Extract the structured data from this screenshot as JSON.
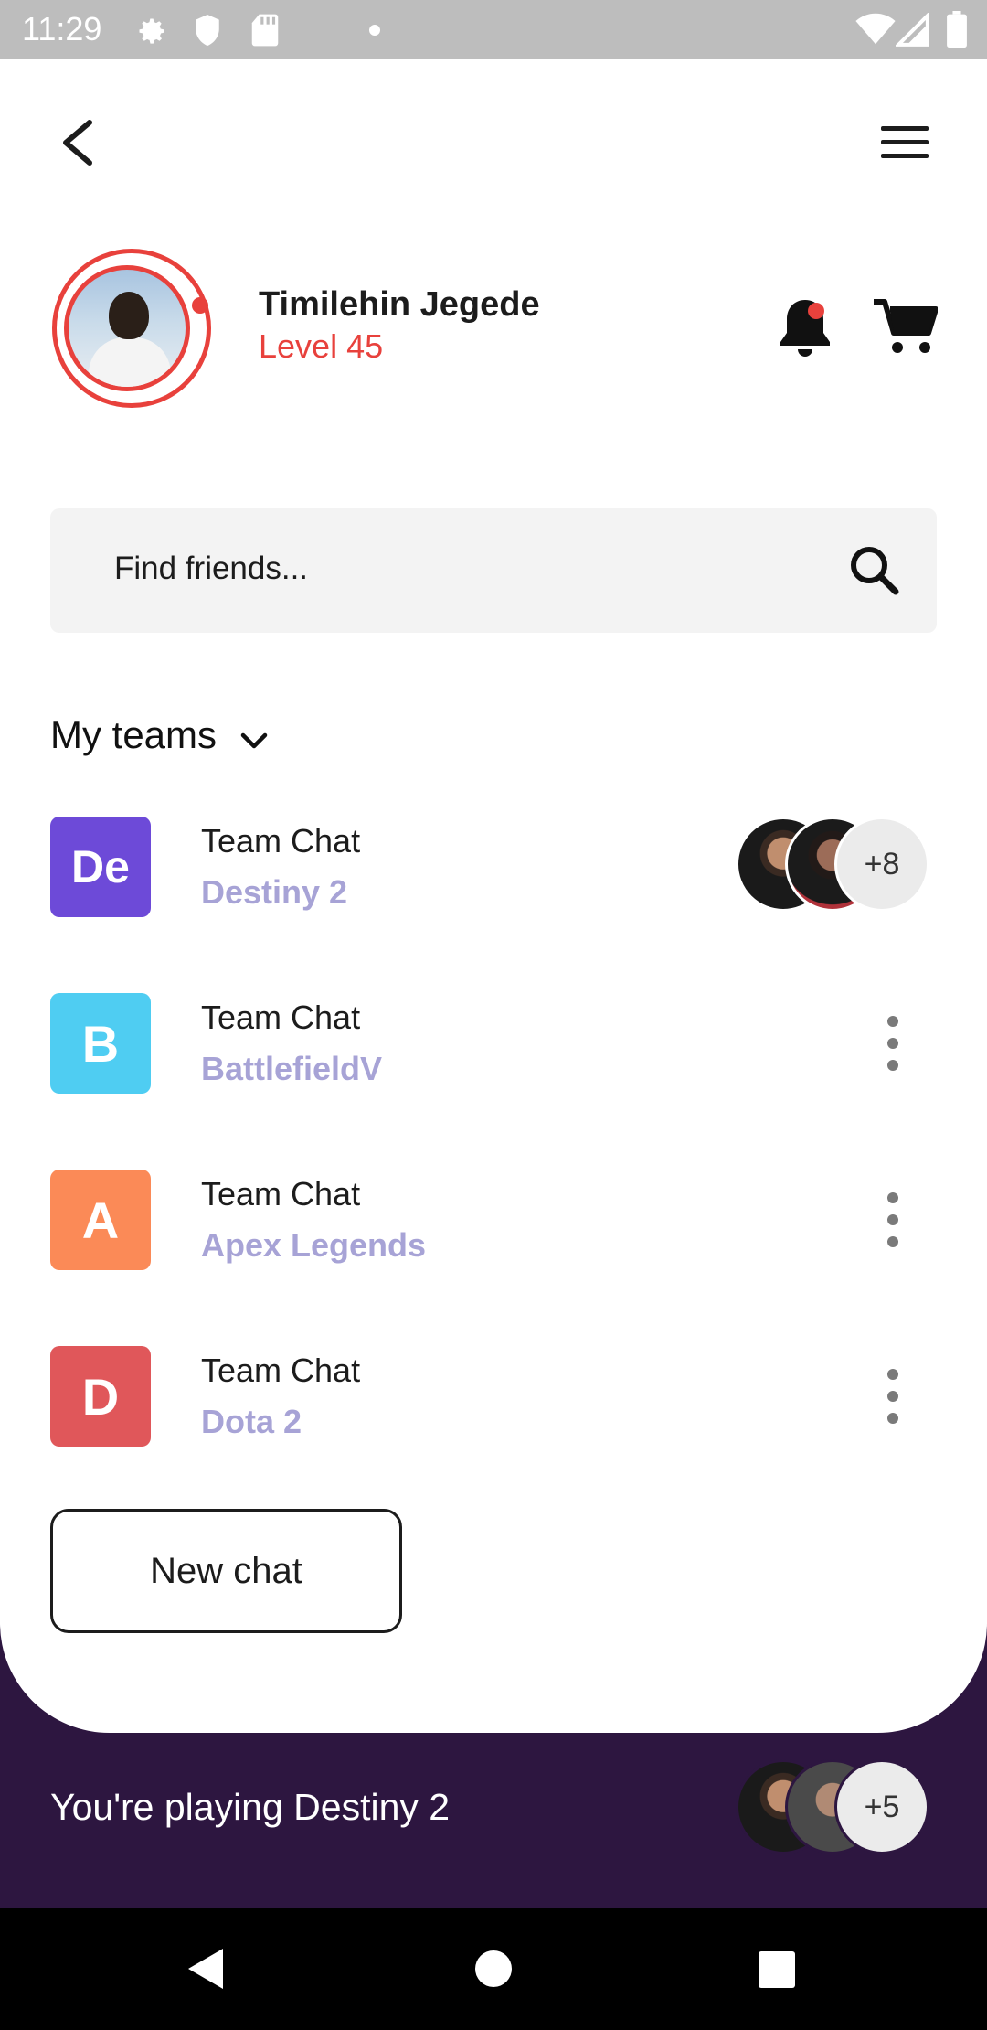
{
  "status_bar": {
    "time": "11:29",
    "icons": [
      "settings-icon",
      "shield-icon",
      "sd-card-icon",
      "dot-icon",
      "wifi-icon",
      "signal-icon",
      "battery-icon"
    ]
  },
  "header": {
    "back_icon": "chevron-left-icon",
    "menu_icon": "hamburger-menu-icon"
  },
  "profile": {
    "name": "Timilehin Jegede",
    "level": "Level 45",
    "accent_color": "#e8413c",
    "notification_icon": "bell-icon",
    "cart_icon": "cart-icon"
  },
  "search": {
    "placeholder": "Find friends...",
    "icon": "search-icon"
  },
  "teams_section": {
    "title": "My teams",
    "icon": "chevron-down-icon"
  },
  "teams": [
    {
      "initials": "De",
      "title": "Team Chat",
      "game": "Destiny 2",
      "color": "#6d4ad8",
      "extra_members": "+8"
    },
    {
      "initials": "B",
      "title": "Team Chat",
      "game": "BattlefieldV",
      "color": "#4fcdf2"
    },
    {
      "initials": "A",
      "title": "Team Chat",
      "game": "Apex Legends",
      "color": "#fb8a57"
    },
    {
      "initials": "D",
      "title": "Team Chat",
      "game": "Dota 2",
      "color": "#e0575a"
    }
  ],
  "new_chat_label": "New chat",
  "now_playing": {
    "text": "You're playing Destiny 2",
    "extra_members": "+5",
    "background": "#2d1640"
  },
  "nav": {
    "icons": [
      "back-nav-icon",
      "home-nav-icon",
      "recents-nav-icon"
    ]
  }
}
